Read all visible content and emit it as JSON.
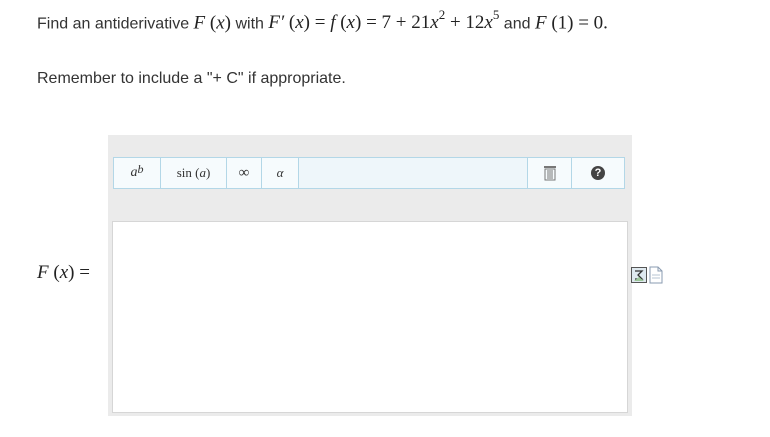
{
  "question": {
    "intro": "Find an antiderivative",
    "fx": "F",
    "var": "x",
    "with": "with",
    "deriv": "F′",
    "eq": "=",
    "f": "f",
    "poly_a": "7 + 21",
    "exp_a": "2",
    "poly_b": " + 12",
    "exp_b": "5",
    "and": "and",
    "cond_lhs": "F",
    "cond_arg": "(1)",
    "cond_rhs": "= 0."
  },
  "reminder": "Remember to include a \"+ C\" if appropriate.",
  "answer_label": {
    "fn": "F",
    "arg": "x",
    "eq": "="
  },
  "toolbar": {
    "power_base": "a",
    "power_exp": "b",
    "sin_label": "sin",
    "sin_arg": "a",
    "infinity": "∞",
    "alpha": "α",
    "help": "?"
  },
  "icons": {
    "trash": "trash-icon",
    "help": "help-icon",
    "preview": "math-preview-icon",
    "doc": "document-icon"
  },
  "colors": {
    "toolbar_border": "#b3d7e7",
    "panel_bg": "#ebebeb"
  }
}
